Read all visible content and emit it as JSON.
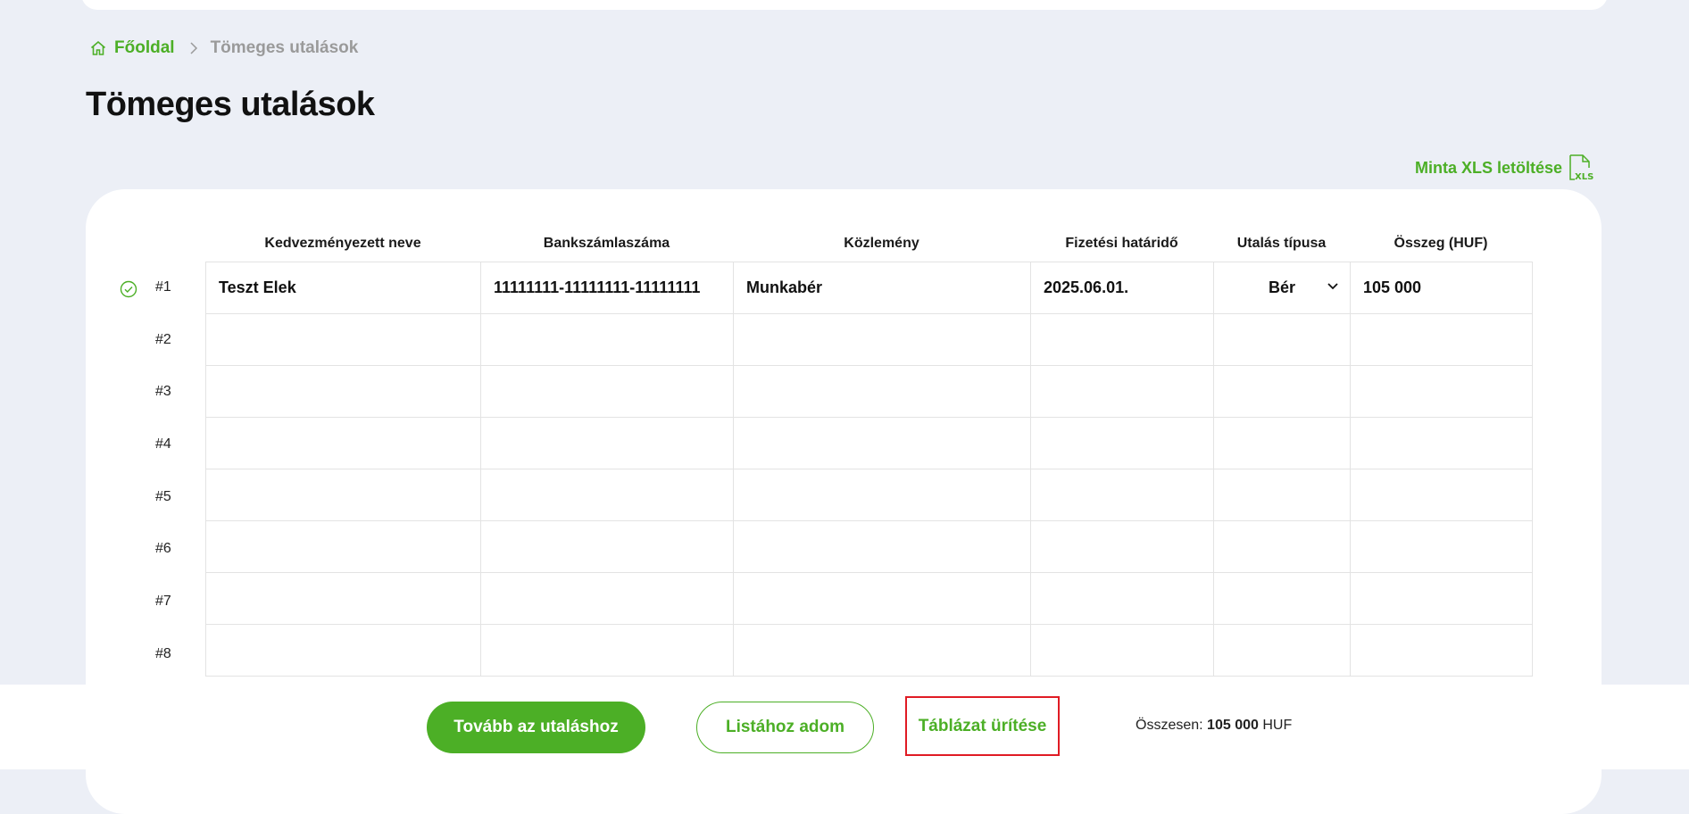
{
  "breadcrumb": {
    "home": "Főoldal",
    "current": "Tömeges utalások"
  },
  "page_title": "Tömeges utalások",
  "xls_link": "Minta XLS letöltése",
  "table": {
    "headers": [
      "Kedvezményezett neve",
      "Bankszámlaszáma",
      "Közlemény",
      "Fizetési határidő",
      "Utalás típusa",
      "Összeg (HUF)"
    ],
    "rows": [
      {
        "num": "#1",
        "name": "Teszt Elek",
        "account": "11111111-11111111-11111111",
        "note": "Munkabér",
        "deadline": "2025.06.01.",
        "type": "Bér",
        "amount": "105 000",
        "status": "valid"
      },
      {
        "num": "#2",
        "name": "",
        "account": "",
        "note": "",
        "deadline": "",
        "type": "",
        "amount": ""
      },
      {
        "num": "#3",
        "name": "",
        "account": "",
        "note": "",
        "deadline": "",
        "type": "",
        "amount": ""
      },
      {
        "num": "#4",
        "name": "",
        "account": "",
        "note": "",
        "deadline": "",
        "type": "",
        "amount": ""
      },
      {
        "num": "#5",
        "name": "",
        "account": "",
        "note": "",
        "deadline": "",
        "type": "",
        "amount": ""
      },
      {
        "num": "#6",
        "name": "",
        "account": "",
        "note": "",
        "deadline": "",
        "type": "",
        "amount": ""
      },
      {
        "num": "#7",
        "name": "",
        "account": "",
        "note": "",
        "deadline": "",
        "type": "",
        "amount": ""
      },
      {
        "num": "#8",
        "name": "",
        "account": "",
        "note": "",
        "deadline": "",
        "type": "",
        "amount": ""
      }
    ]
  },
  "footer": {
    "continue_button": "Tovább az utaláshoz",
    "add_to_list_button": "Listához adom",
    "clear_table_button": "Táblázat ürítése",
    "total_label": "Összesen:",
    "total_value": "105 000",
    "total_currency": "HUF"
  },
  "colors": {
    "accent": "#4caf26",
    "highlight_border": "#e01b24",
    "background": "#eceff6"
  }
}
